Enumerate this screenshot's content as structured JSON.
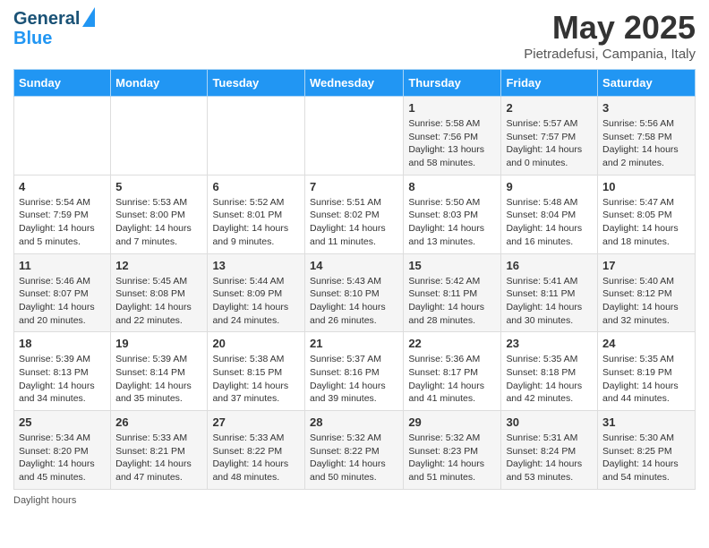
{
  "header": {
    "logo_line1": "General",
    "logo_line2": "Blue",
    "month_title": "May 2025",
    "location": "Pietradefusi, Campania, Italy"
  },
  "weekdays": [
    "Sunday",
    "Monday",
    "Tuesday",
    "Wednesday",
    "Thursday",
    "Friday",
    "Saturday"
  ],
  "weeks": [
    [
      {
        "day": "",
        "sunrise": "",
        "sunset": "",
        "daylight": ""
      },
      {
        "day": "",
        "sunrise": "",
        "sunset": "",
        "daylight": ""
      },
      {
        "day": "",
        "sunrise": "",
        "sunset": "",
        "daylight": ""
      },
      {
        "day": "",
        "sunrise": "",
        "sunset": "",
        "daylight": ""
      },
      {
        "day": "1",
        "sunrise": "Sunrise: 5:58 AM",
        "sunset": "Sunset: 7:56 PM",
        "daylight": "Daylight: 13 hours and 58 minutes."
      },
      {
        "day": "2",
        "sunrise": "Sunrise: 5:57 AM",
        "sunset": "Sunset: 7:57 PM",
        "daylight": "Daylight: 14 hours and 0 minutes."
      },
      {
        "day": "3",
        "sunrise": "Sunrise: 5:56 AM",
        "sunset": "Sunset: 7:58 PM",
        "daylight": "Daylight: 14 hours and 2 minutes."
      }
    ],
    [
      {
        "day": "4",
        "sunrise": "Sunrise: 5:54 AM",
        "sunset": "Sunset: 7:59 PM",
        "daylight": "Daylight: 14 hours and 5 minutes."
      },
      {
        "day": "5",
        "sunrise": "Sunrise: 5:53 AM",
        "sunset": "Sunset: 8:00 PM",
        "daylight": "Daylight: 14 hours and 7 minutes."
      },
      {
        "day": "6",
        "sunrise": "Sunrise: 5:52 AM",
        "sunset": "Sunset: 8:01 PM",
        "daylight": "Daylight: 14 hours and 9 minutes."
      },
      {
        "day": "7",
        "sunrise": "Sunrise: 5:51 AM",
        "sunset": "Sunset: 8:02 PM",
        "daylight": "Daylight: 14 hours and 11 minutes."
      },
      {
        "day": "8",
        "sunrise": "Sunrise: 5:50 AM",
        "sunset": "Sunset: 8:03 PM",
        "daylight": "Daylight: 14 hours and 13 minutes."
      },
      {
        "day": "9",
        "sunrise": "Sunrise: 5:48 AM",
        "sunset": "Sunset: 8:04 PM",
        "daylight": "Daylight: 14 hours and 16 minutes."
      },
      {
        "day": "10",
        "sunrise": "Sunrise: 5:47 AM",
        "sunset": "Sunset: 8:05 PM",
        "daylight": "Daylight: 14 hours and 18 minutes."
      }
    ],
    [
      {
        "day": "11",
        "sunrise": "Sunrise: 5:46 AM",
        "sunset": "Sunset: 8:07 PM",
        "daylight": "Daylight: 14 hours and 20 minutes."
      },
      {
        "day": "12",
        "sunrise": "Sunrise: 5:45 AM",
        "sunset": "Sunset: 8:08 PM",
        "daylight": "Daylight: 14 hours and 22 minutes."
      },
      {
        "day": "13",
        "sunrise": "Sunrise: 5:44 AM",
        "sunset": "Sunset: 8:09 PM",
        "daylight": "Daylight: 14 hours and 24 minutes."
      },
      {
        "day": "14",
        "sunrise": "Sunrise: 5:43 AM",
        "sunset": "Sunset: 8:10 PM",
        "daylight": "Daylight: 14 hours and 26 minutes."
      },
      {
        "day": "15",
        "sunrise": "Sunrise: 5:42 AM",
        "sunset": "Sunset: 8:11 PM",
        "daylight": "Daylight: 14 hours and 28 minutes."
      },
      {
        "day": "16",
        "sunrise": "Sunrise: 5:41 AM",
        "sunset": "Sunset: 8:11 PM",
        "daylight": "Daylight: 14 hours and 30 minutes."
      },
      {
        "day": "17",
        "sunrise": "Sunrise: 5:40 AM",
        "sunset": "Sunset: 8:12 PM",
        "daylight": "Daylight: 14 hours and 32 minutes."
      }
    ],
    [
      {
        "day": "18",
        "sunrise": "Sunrise: 5:39 AM",
        "sunset": "Sunset: 8:13 PM",
        "daylight": "Daylight: 14 hours and 34 minutes."
      },
      {
        "day": "19",
        "sunrise": "Sunrise: 5:39 AM",
        "sunset": "Sunset: 8:14 PM",
        "daylight": "Daylight: 14 hours and 35 minutes."
      },
      {
        "day": "20",
        "sunrise": "Sunrise: 5:38 AM",
        "sunset": "Sunset: 8:15 PM",
        "daylight": "Daylight: 14 hours and 37 minutes."
      },
      {
        "day": "21",
        "sunrise": "Sunrise: 5:37 AM",
        "sunset": "Sunset: 8:16 PM",
        "daylight": "Daylight: 14 hours and 39 minutes."
      },
      {
        "day": "22",
        "sunrise": "Sunrise: 5:36 AM",
        "sunset": "Sunset: 8:17 PM",
        "daylight": "Daylight: 14 hours and 41 minutes."
      },
      {
        "day": "23",
        "sunrise": "Sunrise: 5:35 AM",
        "sunset": "Sunset: 8:18 PM",
        "daylight": "Daylight: 14 hours and 42 minutes."
      },
      {
        "day": "24",
        "sunrise": "Sunrise: 5:35 AM",
        "sunset": "Sunset: 8:19 PM",
        "daylight": "Daylight: 14 hours and 44 minutes."
      }
    ],
    [
      {
        "day": "25",
        "sunrise": "Sunrise: 5:34 AM",
        "sunset": "Sunset: 8:20 PM",
        "daylight": "Daylight: 14 hours and 45 minutes."
      },
      {
        "day": "26",
        "sunrise": "Sunrise: 5:33 AM",
        "sunset": "Sunset: 8:21 PM",
        "daylight": "Daylight: 14 hours and 47 minutes."
      },
      {
        "day": "27",
        "sunrise": "Sunrise: 5:33 AM",
        "sunset": "Sunset: 8:22 PM",
        "daylight": "Daylight: 14 hours and 48 minutes."
      },
      {
        "day": "28",
        "sunrise": "Sunrise: 5:32 AM",
        "sunset": "Sunset: 8:22 PM",
        "daylight": "Daylight: 14 hours and 50 minutes."
      },
      {
        "day": "29",
        "sunrise": "Sunrise: 5:32 AM",
        "sunset": "Sunset: 8:23 PM",
        "daylight": "Daylight: 14 hours and 51 minutes."
      },
      {
        "day": "30",
        "sunrise": "Sunrise: 5:31 AM",
        "sunset": "Sunset: 8:24 PM",
        "daylight": "Daylight: 14 hours and 53 minutes."
      },
      {
        "day": "31",
        "sunrise": "Sunrise: 5:30 AM",
        "sunset": "Sunset: 8:25 PM",
        "daylight": "Daylight: 14 hours and 54 minutes."
      }
    ]
  ],
  "footer": {
    "label": "Daylight hours"
  }
}
